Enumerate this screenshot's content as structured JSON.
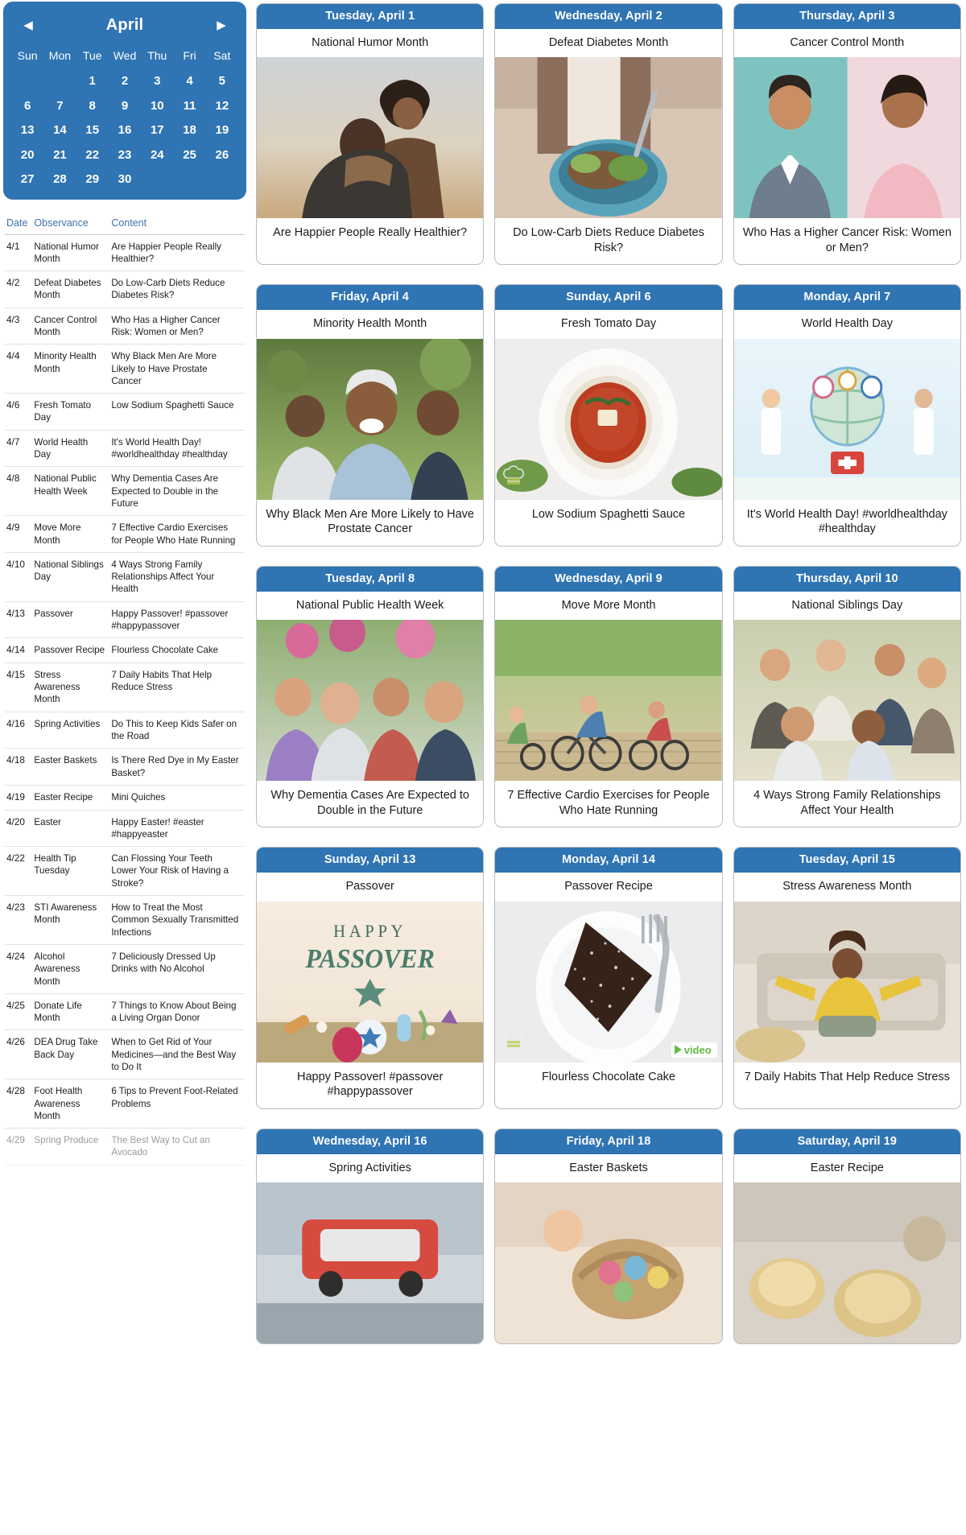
{
  "calendar": {
    "month": "April",
    "prev_label": "◀",
    "next_label": "▶",
    "dow": [
      "Sun",
      "Mon",
      "Tue",
      "Wed",
      "Thu",
      "Fri",
      "Sat"
    ],
    "lead_blanks": 2,
    "days": [
      1,
      2,
      3,
      4,
      5,
      6,
      7,
      8,
      9,
      10,
      11,
      12,
      13,
      14,
      15,
      16,
      17,
      18,
      19,
      20,
      21,
      22,
      23,
      24,
      25,
      26,
      27,
      28,
      29,
      30
    ],
    "accent": "#2f74b3",
    "text_color": "#ffffff"
  },
  "table": {
    "headers": [
      "Date",
      "Observance",
      "Content"
    ],
    "header_color": "#3d72a8",
    "rows": [
      {
        "date": "4/1",
        "observance": "National Humor Month",
        "content": "Are Happier People Really Healthier?"
      },
      {
        "date": "4/2",
        "observance": "Defeat Diabetes Month",
        "content": "Do Low-Carb Diets Reduce Diabetes Risk?"
      },
      {
        "date": "4/3",
        "observance": "Cancer Control Month",
        "content": "Who Has a Higher Cancer Risk: Women or Men?"
      },
      {
        "date": "4/4",
        "observance": "Minority Health Month",
        "content": "Why Black Men Are More Likely to Have Prostate Cancer"
      },
      {
        "date": "4/6",
        "observance": "Fresh Tomato Day",
        "content": "Low Sodium Spaghetti Sauce"
      },
      {
        "date": "4/7",
        "observance": "World Health Day",
        "content": "It's World Health Day! #worldhealthday #healthday"
      },
      {
        "date": "4/8",
        "observance": "National Public Health Week",
        "content": "Why Dementia Cases Are Expected to Double in the Future"
      },
      {
        "date": "4/9",
        "observance": "Move More Month",
        "content": "7 Effective Cardio Exercises for People Who Hate Running"
      },
      {
        "date": "4/10",
        "observance": "National Siblings Day",
        "content": "4 Ways Strong Family Relationships Affect Your Health"
      },
      {
        "date": "4/13",
        "observance": "Passover",
        "content": "Happy Passover! #passover #happypassover"
      },
      {
        "date": "4/14",
        "observance": "Passover Recipe",
        "content": "Flourless Chocolate Cake"
      },
      {
        "date": "4/15",
        "observance": "Stress Awareness Month",
        "content": "7 Daily Habits That Help Reduce Stress"
      },
      {
        "date": "4/16",
        "observance": "Spring Activities",
        "content": "Do This to Keep Kids Safer on the Road"
      },
      {
        "date": "4/18",
        "observance": "Easter Baskets",
        "content": "Is There Red Dye in My Easter Basket?"
      },
      {
        "date": "4/19",
        "observance": "Easter Recipe",
        "content": "Mini Quiches"
      },
      {
        "date": "4/20",
        "observance": "Easter",
        "content": "Happy Easter! #easter #happyeaster"
      },
      {
        "date": "4/22",
        "observance": "Health Tip Tuesday",
        "content": "Can Flossing Your Teeth Lower Your Risk of Having a Stroke?"
      },
      {
        "date": "4/23",
        "observance": "STI Awareness Month",
        "content": "How to Treat the Most Common Sexually Transmitted Infections"
      },
      {
        "date": "4/24",
        "observance": "Alcohol Awareness Month",
        "content": "7 Deliciously Dressed Up Drinks with No Alcohol"
      },
      {
        "date": "4/25",
        "observance": "Donate Life Month",
        "content": "7 Things to Know About Being a Living Organ Donor"
      },
      {
        "date": "4/26",
        "observance": "DEA Drug Take Back Day",
        "content": "When to Get Rid of Your Medicines—and the Best Way to Do It"
      },
      {
        "date": "4/28",
        "observance": "Foot Health Awareness Month",
        "content": "6 Tips to Prevent Foot-Related Problems"
      },
      {
        "date": "4/29",
        "observance": "Spring Produce",
        "content": "The Best Way to Cut an Avocado",
        "faded": true
      }
    ]
  },
  "cards": [
    {
      "day": "Tuesday, April 1",
      "observance": "National Humor Month",
      "caption": "Are Happier People Really Healthier?",
      "image": "couple-hug-sunset"
    },
    {
      "day": "Wednesday, April 2",
      "observance": "Defeat Diabetes Month",
      "caption": "Do Low-Carb Diets Reduce Diabetes Risk?",
      "image": "salad-bowl"
    },
    {
      "day": "Thursday, April 3",
      "observance": "Cancer Control Month",
      "caption": "Who Has a Higher Cancer Risk: Women or Men?",
      "image": "man-woman-portraits"
    },
    {
      "day": "Friday, April 4",
      "observance": "Minority Health Month",
      "caption": "Why Black Men Are More Likely to Have Prostate Cancer",
      "image": "men-laughing-outdoors"
    },
    {
      "day": "Sunday, April 6",
      "observance": "Fresh Tomato Day",
      "caption": "Low Sodium Spaghetti Sauce",
      "image": "spaghetti-plate",
      "chef": true
    },
    {
      "day": "Monday, April 7",
      "observance": "World Health Day",
      "caption": "It's World Health Day! #worldhealthday #healthday",
      "image": "world-health-day-graphic"
    },
    {
      "day": "Tuesday, April 8",
      "observance": "National Public Health Week",
      "caption": "Why Dementia Cases Are Expected to Double in the Future",
      "image": "seniors-group"
    },
    {
      "day": "Wednesday, April 9",
      "observance": "Move More Month",
      "caption": "7 Effective Cardio Exercises for People Who Hate Running",
      "image": "cyclists-bridge"
    },
    {
      "day": "Thursday, April 10",
      "observance": "National Siblings Day",
      "caption": "4 Ways Strong Family Relationships Affect Your Health",
      "image": "family-group"
    },
    {
      "day": "Sunday, April 13",
      "observance": "Passover",
      "caption": "Happy Passover! #passover #happypassover",
      "image": "happy-passover-graphic",
      "graphic_text": [
        "HAPPY",
        "PASSOVER"
      ]
    },
    {
      "day": "Monday, April 14",
      "observance": "Passover Recipe",
      "caption": "Flourless Chocolate Cake",
      "image": "chocolate-cake-slice",
      "chef": true,
      "video": "video"
    },
    {
      "day": "Tuesday, April 15",
      "observance": "Stress Awareness Month",
      "caption": "7 Daily Habits That Help Reduce Stress",
      "image": "woman-relaxing-couch"
    },
    {
      "day": "Wednesday, April 16",
      "observance": "Spring Activities",
      "caption": "",
      "image": "spring-activity"
    },
    {
      "day": "Friday, April 18",
      "observance": "Easter Baskets",
      "caption": "",
      "image": "easter-basket"
    },
    {
      "day": "Saturday, April 19",
      "observance": "Easter Recipe",
      "caption": "",
      "image": "mini-quiches"
    }
  ],
  "colors": {
    "accent": "#2f74b3",
    "card_border": "#b9bcbe",
    "video_green": "#62bb46"
  }
}
